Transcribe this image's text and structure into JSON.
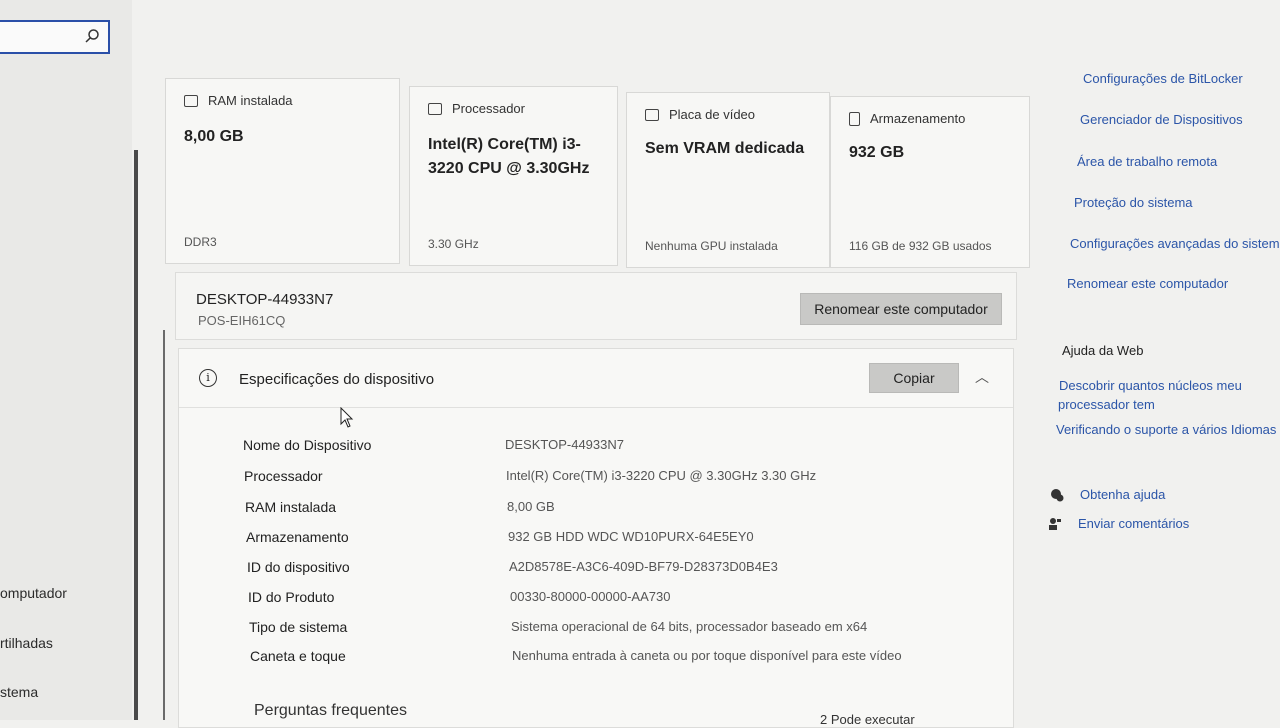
{
  "sidebar": {
    "items": [
      "omputador",
      "rtilhadas",
      "stema"
    ]
  },
  "cards": [
    {
      "icon": "ram-icon",
      "title": "RAM instalada",
      "value": "8,00 GB",
      "sub": "DDR3"
    },
    {
      "icon": "processor-icon",
      "title": "Processador",
      "value": "Intel(R) Core(TM) i3-3220 CPU @ 3.30GHz",
      "sub": "3.30 GHz"
    },
    {
      "icon": "gpu-icon",
      "title": "Placa de vídeo",
      "value": "Sem VRAM dedicada",
      "sub": "Nenhuma GPU instalada"
    },
    {
      "icon": "storage-icon",
      "title": "Armazenamento",
      "value": "932 GB",
      "sub": "116 GB de 932 GB usados"
    }
  ],
  "device": {
    "name": "DESKTOP-44933N7",
    "model": "POS-EIH61CQ",
    "rename_button": "Renomear este computador"
  },
  "specs": {
    "title": "Especificações do dispositivo",
    "copy_button": "Copiar",
    "rows": [
      {
        "k": "Nome do Dispositivo",
        "v": "DESKTOP-44933N7"
      },
      {
        "k": "Processador",
        "v": "Intel(R) Core(TM) i3-3220 CPU @ 3.30GHz   3.30 GHz"
      },
      {
        "k": "RAM instalada",
        "v": "8,00 GB"
      },
      {
        "k": "Armazenamento",
        "v": "932 GB HDD WDC WD10PURX-64E5EY0"
      },
      {
        "k": "ID do dispositivo",
        "v": "A2D8578E-A3C6-409D-BF79-D28373D0B4E3"
      },
      {
        "k": "ID do Produto",
        "v": "00330-80000-00000-AA730"
      },
      {
        "k": "Tipo de sistema",
        "v": "Sistema operacional de 64 bits, processador baseado em x64"
      },
      {
        "k": "Caneta e toque",
        "v": "Nenhuma entrada à caneta ou por toque disponível para este vídeo"
      }
    ]
  },
  "faq": {
    "title": "Perguntas frequentes",
    "partial": "2 Pode executar"
  },
  "right": {
    "links": [
      "Configurações de BitLocker",
      "Gerenciador de Dispositivos",
      "Área de trabalho remota",
      "Proteção do sistema",
      "Configurações avançadas do sistema",
      "Renomear este computador"
    ],
    "web_title": "Ajuda da Web",
    "web_links": [
      "Descobrir quantos núcleos meu",
      "processador tem",
      "Verificando o suporte a vários Idiomas"
    ],
    "help": "Obtenha ajuda",
    "feedback": "Enviar comentários"
  }
}
